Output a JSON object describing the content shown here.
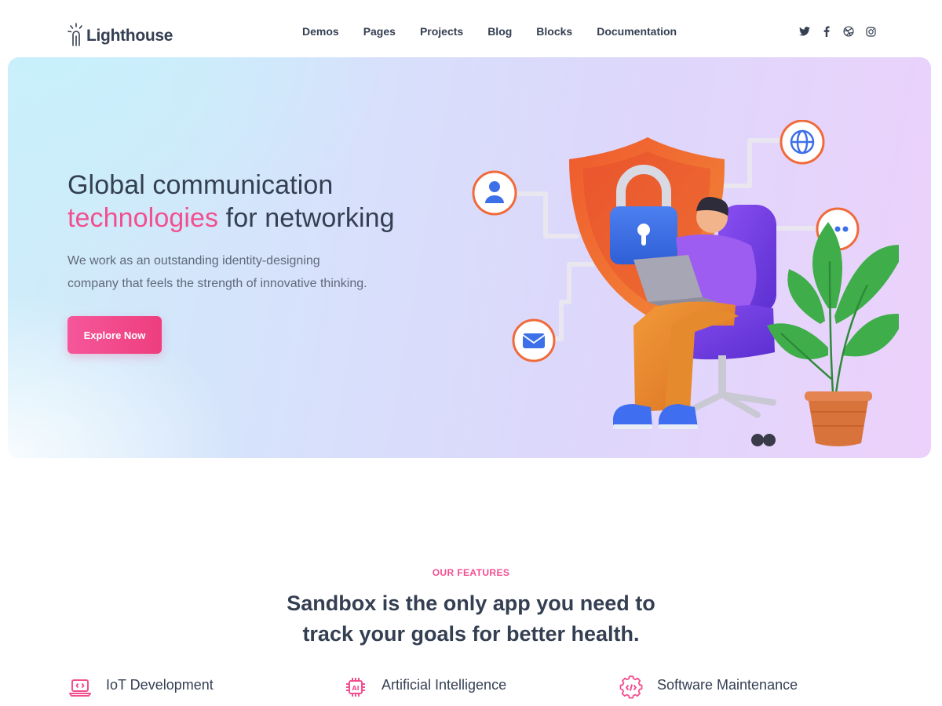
{
  "brand": {
    "name": "Lighthouse",
    "logo_icon": "lighthouse-logo-icon",
    "accent_color": "#f24f8f"
  },
  "nav": {
    "items": [
      "Demos",
      "Pages",
      "Projects",
      "Blog",
      "Blocks",
      "Documentation"
    ]
  },
  "social": {
    "icons": [
      "twitter-icon",
      "facebook-icon",
      "dribbble-icon",
      "instagram-icon"
    ]
  },
  "hero": {
    "title_line1": "Global communication",
    "title_accent": "technologies",
    "title_rest": " for networking",
    "description_line1": "We work as an outstanding identity-designing",
    "description_line2": "company that feels the strength of innovative thinking.",
    "button_label": "Explore Now",
    "illustration": "person-with-laptop-security-shield-illustration"
  },
  "features": {
    "kicker": "OUR FEATURES",
    "title_line1": "Sandbox is the only app you need to",
    "title_line2": "track your goals for better health.",
    "items": [
      {
        "title": "IoT Development",
        "icon": "laptop-code-icon"
      },
      {
        "title": "Artificial Intelligence",
        "icon": "ai-chip-icon"
      },
      {
        "title": "Software Maintenance",
        "icon": "gear-code-icon"
      }
    ]
  }
}
